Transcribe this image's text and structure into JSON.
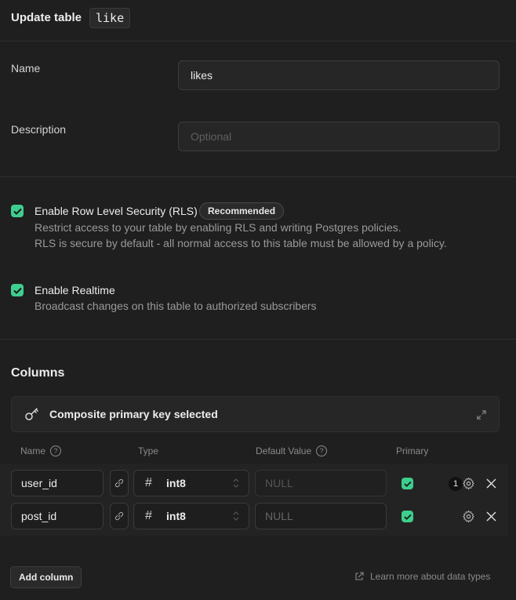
{
  "header": {
    "title": "Update table",
    "table_code": "like"
  },
  "form": {
    "name_label": "Name",
    "name_value": "likes",
    "description_label": "Description",
    "description_placeholder": "Optional"
  },
  "options": {
    "rls": {
      "title": "Enable Row Level Security (RLS)",
      "badge": "Recommended",
      "desc_line1": "Restrict access to your table by enabling RLS and writing Postgres policies.",
      "desc_line2": "RLS is secure by default - all normal access to this table must be allowed by a policy.",
      "checked": true
    },
    "realtime": {
      "title": "Enable Realtime",
      "desc": "Broadcast changes on this table to authorized subscribers",
      "checked": true
    }
  },
  "columns": {
    "section_title": "Columns",
    "pk_notice": "Composite primary key selected",
    "headers": {
      "name": "Name",
      "type": "Type",
      "default": "Default Value",
      "primary": "Primary"
    },
    "rows": [
      {
        "name": "user_id",
        "type": "int8",
        "default_placeholder": "NULL",
        "primary": true,
        "settings_count": "1"
      },
      {
        "name": "post_id",
        "type": "int8",
        "default_placeholder": "NULL",
        "primary": true
      }
    ]
  },
  "footer": {
    "add_column": "Add column",
    "learn_more": "Learn more about data types"
  },
  "colors": {
    "accent": "#3ecf8e",
    "background": "#1f1f1f"
  },
  "icons": [
    "check-icon",
    "key-icon",
    "expand-icon",
    "help-icon",
    "link-icon",
    "hash-icon",
    "chevron-updown-icon",
    "gear-icon",
    "close-icon",
    "external-link-icon"
  ]
}
